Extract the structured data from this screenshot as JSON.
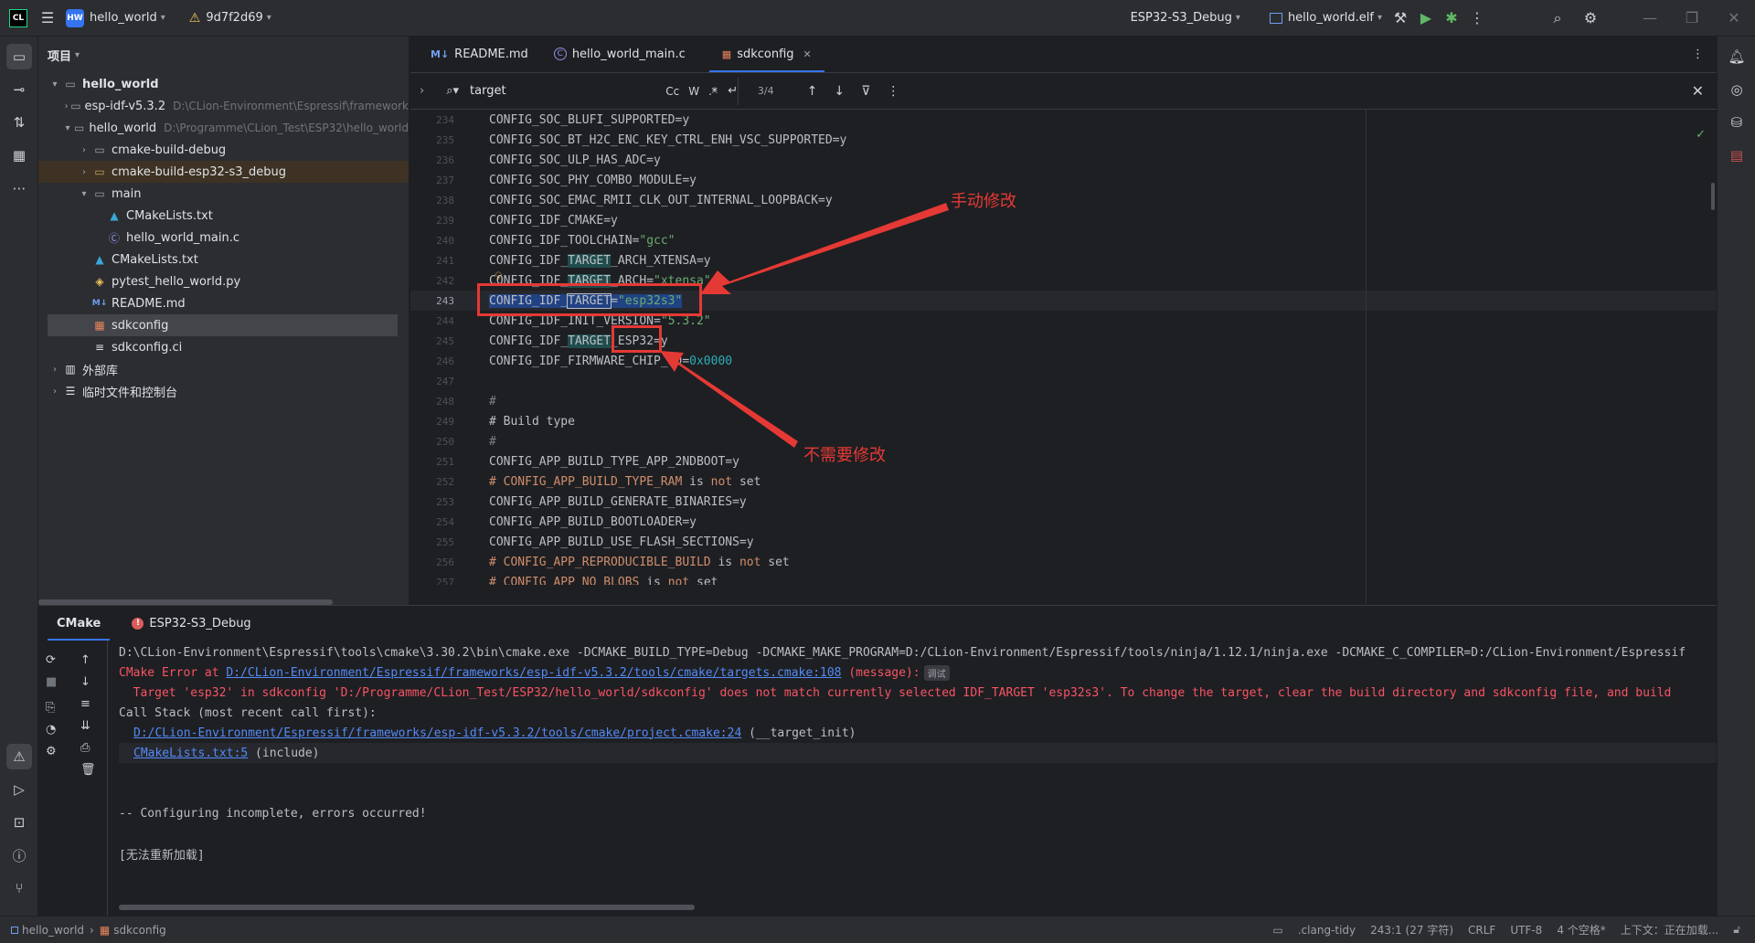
{
  "titlebar": {
    "app_logo": "CL",
    "project_badge": "HW",
    "project_name": "hello_world",
    "vcs_commit": "9d7f2d69",
    "run_config": "ESP32-S3_Debug",
    "target": "hello_world.elf"
  },
  "project_panel": {
    "title": "项目",
    "tree": [
      {
        "label": "hello_world",
        "path": ""
      },
      {
        "label": "esp-idf-v5.3.2",
        "path": "D:\\CLion-Environment\\Espressif\\framework"
      },
      {
        "label": "hello_world",
        "path": "D:\\Programme\\CLion_Test\\ESP32\\hello_world"
      },
      {
        "label": "cmake-build-debug",
        "path": ""
      },
      {
        "label": "cmake-build-esp32-s3_debug",
        "path": ""
      },
      {
        "label": "main",
        "path": ""
      },
      {
        "label": "CMakeLists.txt",
        "path": ""
      },
      {
        "label": "hello_world_main.c",
        "path": ""
      },
      {
        "label": "CMakeLists.txt",
        "path": ""
      },
      {
        "label": "pytest_hello_world.py",
        "path": ""
      },
      {
        "label": "README.md",
        "path": ""
      },
      {
        "label": "sdkconfig",
        "path": ""
      },
      {
        "label": "sdkconfig.ci",
        "path": ""
      },
      {
        "label": "外部库",
        "path": ""
      },
      {
        "label": "临时文件和控制台",
        "path": ""
      }
    ]
  },
  "editor": {
    "tabs": [
      {
        "label": "README.md",
        "icon": "M↓"
      },
      {
        "label": "hello_world_main.c",
        "icon": "C"
      },
      {
        "label": "sdkconfig",
        "icon": "▦"
      }
    ],
    "find": {
      "query": "target",
      "options": [
        "Cc",
        "W",
        ".*"
      ],
      "match_count": "3/4"
    },
    "lines": [
      {
        "num": "234",
        "text": "CONFIG_SOC_BLUFI_SUPPORTED=y"
      },
      {
        "num": "235",
        "text": "CONFIG_SOC_BT_H2C_ENC_KEY_CTRL_ENH_VSC_SUPPORTED=y"
      },
      {
        "num": "236",
        "text": "CONFIG_SOC_ULP_HAS_ADC=y"
      },
      {
        "num": "237",
        "text": "CONFIG_SOC_PHY_COMBO_MODULE=y"
      },
      {
        "num": "238",
        "text": "CONFIG_SOC_EMAC_RMII_CLK_OUT_INTERNAL_LOOPBACK=y"
      },
      {
        "num": "239",
        "text": "CONFIG_IDF_CMAKE=y"
      },
      {
        "num": "240",
        "pre": "CONFIG_IDF_TOOLCHAIN=",
        "str": "\"gcc\""
      },
      {
        "num": "241",
        "pre": "CONFIG_IDF_",
        "hl": "TARGET",
        "post": "_ARCH_XTENSA=y"
      },
      {
        "num": "242",
        "pre": "CONFIG_IDF_",
        "hl": "TARGET",
        "post": "_ARCH=",
        "str": "\"xtensa\""
      },
      {
        "num": "243",
        "pre": "CONFIG_IDF_",
        "hl": "TARGET",
        "post": "=",
        "str": "\"esp32s3\""
      },
      {
        "num": "244",
        "pre": "CONFIG_IDF_INIT_VERSION=",
        "str": "\"5.3.2\""
      },
      {
        "num": "245",
        "pre": "CONFIG_IDF_",
        "hl": "TARGET",
        "post": "_ESP32=y"
      },
      {
        "num": "246",
        "pre": "CONFIG_IDF_FIRMWARE_CHIP_ID=",
        "hex": "0x0000"
      },
      {
        "num": "247",
        "text": ""
      },
      {
        "num": "248",
        "cmt": "#"
      },
      {
        "num": "249",
        "text": "# Build type"
      },
      {
        "num": "250",
        "cmt": "#"
      },
      {
        "num": "251",
        "text": "CONFIG_APP_BUILD_TYPE_APP_2NDBOOT=y"
      },
      {
        "num": "252",
        "c1": "# CONFIG_APP_BUILD_TYPE_RAM",
        "c2": " is ",
        "c3": "not",
        "c4": " set"
      },
      {
        "num": "253",
        "text": "CONFIG_APP_BUILD_GENERATE_BINARIES=y"
      },
      {
        "num": "254",
        "text": "CONFIG_APP_BUILD_BOOTLOADER=y"
      },
      {
        "num": "255",
        "text": "CONFIG_APP_BUILD_USE_FLASH_SECTIONS=y"
      },
      {
        "num": "256",
        "c1": "# CONFIG_APP_REPRODUCIBLE_BUILD",
        "c2": " is ",
        "c3": "not",
        "c4": " set"
      },
      {
        "num": "257",
        "c1": "# CONFIG_APP_NO_BLOBS",
        "c2": " is ",
        "c3": "not",
        "c4": " set"
      }
    ]
  },
  "annotations": {
    "modify": "手动修改",
    "no_modify": "不需要修改"
  },
  "bottom_panel": {
    "tabs": [
      "CMake",
      "ESP32-S3_Debug"
    ],
    "console": {
      "cmd": "D:\\CLion-Environment\\Espressif\\tools\\cmake\\3.30.2\\bin\\cmake.exe -DCMAKE_BUILD_TYPE=Debug -DCMAKE_MAKE_PROGRAM=D:/CLion-Environment/Espressif/tools/ninja/1.12.1/ninja.exe -DCMAKE_C_COMPILER=D:/CLion-Environment/Espressif",
      "err_prefix": "CMake Error at ",
      "err_link": "D:/CLion-Environment/Espressif/frameworks/esp-idf-v5.3.2/tools/cmake/targets.cmake:108",
      "err_suffix": " (message):",
      "err_tag": "调试",
      "err_msg": "  Target 'esp32' in sdkconfig 'D:/Programme/CLion_Test/ESP32/hello_world/sdkconfig' does not match currently selected IDF_TARGET 'esp32s3'. To change the target, clear the build directory and sdkconfig file, and build",
      "stack": "Call Stack (most recent call first):",
      "stack1_link": "D:/CLion-Environment/Espressif/frameworks/esp-idf-v5.3.2/tools/cmake/project.cmake:24",
      "stack1_suffix": " (__target_init)",
      "stack2_link": "CMakeLists.txt:5",
      "stack2_suffix": " (include)",
      "incomplete": "-- Configuring incomplete, errors occurred!",
      "reload": "[无法重新加载]"
    }
  },
  "statusbar": {
    "crumb1": "hello_world",
    "crumb2": "sdkconfig",
    "clang_tidy": ".clang-tidy",
    "position": "243:1 (27 字符)",
    "line_sep": "CRLF",
    "encoding": "UTF-8",
    "indent": "4 个空格*",
    "context": "上下文：正在加载..."
  }
}
